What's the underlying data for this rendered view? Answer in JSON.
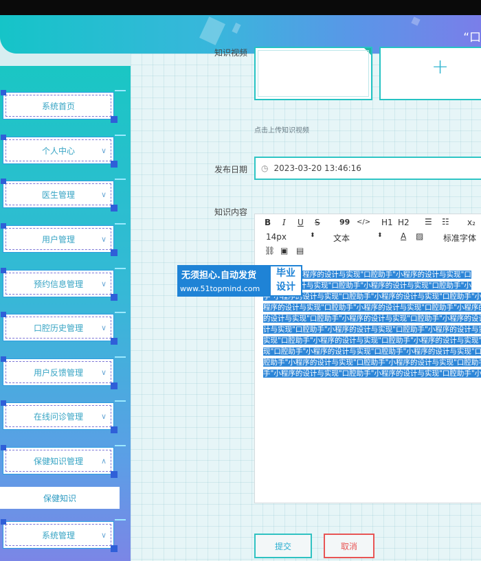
{
  "header": {
    "title": "“口"
  },
  "form": {
    "video_label": "知识视频",
    "upload_hint": "点击上传知识视频",
    "plus_symbol": "+",
    "date_label": "发布日期",
    "date_value": "2023-03-20 13:46:16",
    "content_label": "知识内容"
  },
  "editor": {
    "toolbar": {
      "bold": "B",
      "italic": "I",
      "underline": "U",
      "strike": "S",
      "quote": "99",
      "code": "</>",
      "h1": "H1",
      "h2": "H2",
      "sub": "x₂",
      "size": "14px",
      "format": "文本",
      "font": "标准字体"
    },
    "content_lines": [
      "口腔助手\"小程序的设计与实现\"口腔助手\"小程序的设计与实现\"口",
      "小程序的设计与实现\"口腔助手\"小程序的设计与实现\"口腔助手\"小",
      "手\"小程序的设计与实现\"口腔助手\"小程序的设计与实现\"口腔助手\"小程",
      "程序的设计与实现\"口腔助手\"小程序的设计与实现\"口腔助手\"小程序的设计",
      "的设计与实现\"口腔助手\"小程序的设计与实现\"口腔助手\"小程序的设计与",
      "计与实现\"口腔助手\"小程序的设计与实现\"口腔助手\"小程序的设计与实现\"",
      "实现\"口腔助手\"小程序的设计与实现\"口腔助手\"小程序的设计与实现\"口腔",
      "现\"口腔助手\"小程序的设计与实现\"口腔助手\"小程序的设计与实现\"口腔助",
      "腔助手\"小程序的设计与实现\"口腔助手\"小程序的设计与实现\"口腔助手\"小",
      "手\"小程序的设计与实现\"口腔助手\"小程序的设计与实现\"口腔助手\"小程"
    ]
  },
  "sidebar": {
    "items": [
      {
        "label": "系统首页",
        "chevron": ""
      },
      {
        "label": "个人中心",
        "chevron": "∨"
      },
      {
        "label": "医生管理",
        "chevron": "∨"
      },
      {
        "label": "用户管理",
        "chevron": "∨"
      },
      {
        "label": "预约信息管理",
        "chevron": "∨"
      },
      {
        "label": "口腔历史管理",
        "chevron": "∨"
      },
      {
        "label": "用户反馈管理",
        "chevron": "∨"
      },
      {
        "label": "在线问诊管理",
        "chevron": "∨"
      },
      {
        "label": "保健知识管理",
        "chevron": "∧"
      },
      {
        "label": "系统管理",
        "chevron": "∨"
      }
    ],
    "submenu": {
      "label": "保健知识"
    }
  },
  "watermark": {
    "line1": "无须担心.自动发货",
    "line2": "www.51topmind.com",
    "badge_top": "毕业",
    "badge_bottom": "设计"
  },
  "buttons": {
    "submit": "提交",
    "cancel": "取消"
  }
}
